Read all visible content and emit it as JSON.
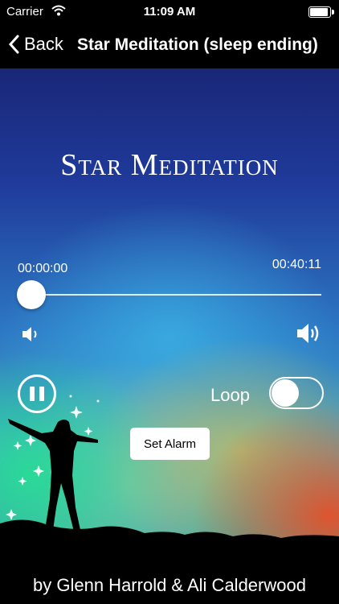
{
  "status_bar": {
    "carrier": "Carrier",
    "time": "11:09 AM"
  },
  "nav": {
    "back_label": "Back",
    "title": "Star Meditation (sleep ending)"
  },
  "main": {
    "app_title": "Star Meditation",
    "elapsed": "00:00:00",
    "duration": "00:40:11",
    "progress_fraction": 0,
    "loop_label": "Loop",
    "loop_on": false,
    "alarm_button": "Set Alarm",
    "credit": "by Glenn Harrold & Ali Calderwood"
  },
  "icons": {
    "back": "chevron-left-icon",
    "wifi": "wifi-icon",
    "battery": "battery-icon",
    "volume_low": "volume-low-icon",
    "volume_high": "volume-high-icon",
    "pause": "pause-icon"
  },
  "colors": {
    "bars": "#000000",
    "button_bg": "#ffffff",
    "text": "#ffffff"
  }
}
